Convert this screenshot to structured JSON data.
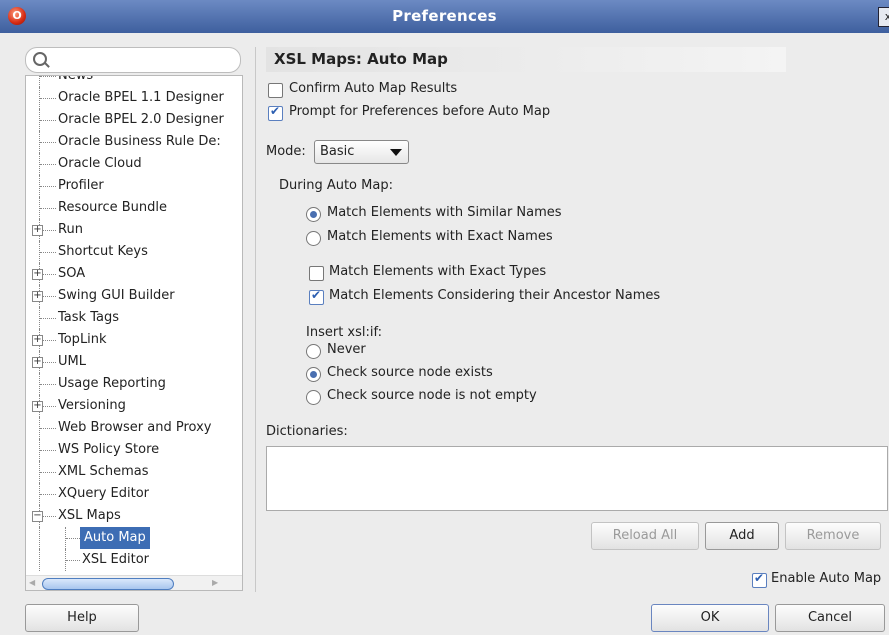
{
  "window": {
    "title": "Preferences",
    "close_label": "x",
    "app_icon_glyph": "O"
  },
  "sidebar": {
    "search_placeholder": "",
    "items": [
      {
        "label": "News"
      },
      {
        "label": "Oracle BPEL 1.1 Designer"
      },
      {
        "label": "Oracle BPEL 2.0 Designer"
      },
      {
        "label": "Oracle Business Rule De:"
      },
      {
        "label": "Oracle Cloud"
      },
      {
        "label": "Profiler"
      },
      {
        "label": "Resource Bundle"
      },
      {
        "label": "Run",
        "expandable": true
      },
      {
        "label": "Shortcut Keys"
      },
      {
        "label": "SOA",
        "expandable": true
      },
      {
        "label": "Swing GUI Builder",
        "expandable": true
      },
      {
        "label": "Task Tags"
      },
      {
        "label": "TopLink",
        "expandable": true
      },
      {
        "label": "UML",
        "expandable": true
      },
      {
        "label": "Usage Reporting"
      },
      {
        "label": "Versioning",
        "expandable": true
      },
      {
        "label": "Web Browser and Proxy"
      },
      {
        "label": "WS Policy Store"
      },
      {
        "label": "XML Schemas"
      },
      {
        "label": "XQuery Editor"
      },
      {
        "label": "XSL Maps",
        "expanded": true
      },
      {
        "label": "Auto Map",
        "selected": true,
        "child": true
      },
      {
        "label": "XSL Editor",
        "child": true
      }
    ]
  },
  "panel": {
    "header": "XSL Maps: Auto Map",
    "confirm_label": "Confirm Auto Map Results",
    "confirm_checked": false,
    "prompt_label": "Prompt for Preferences before Auto Map",
    "prompt_checked": true,
    "mode_label": "Mode:",
    "mode_value": "Basic",
    "during_label": "During Auto Map:",
    "match_similar": "Match Elements with Similar Names",
    "match_exact": "Match Elements with Exact Names",
    "match_types": "Match Elements with Exact Types",
    "match_ancestor": "Match Elements Considering their Ancestor Names",
    "insert_label": "Insert xsl:if:",
    "never": "Never",
    "check_exists": "Check source node exists",
    "check_not_empty": "Check source node is not empty",
    "dictionaries_label": "Dictionaries:",
    "reload_all": "Reload All",
    "add": "Add",
    "remove": "Remove",
    "enable_label": "Enable Auto Map",
    "enable_checked": true
  },
  "footer": {
    "help": "Help",
    "ok": "OK",
    "cancel": "Cancel"
  }
}
